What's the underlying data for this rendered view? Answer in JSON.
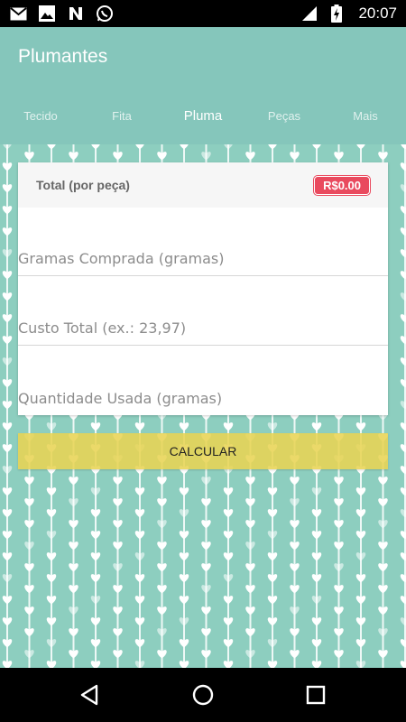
{
  "status_bar": {
    "time": "20:07",
    "left_icons": [
      "gmail-icon",
      "photos-icon",
      "n-app-icon",
      "whatsapp-icon"
    ],
    "right_icons": [
      "wifi-icon",
      "battery-charging-icon"
    ]
  },
  "app": {
    "title": "Plumantes",
    "colors": {
      "app_bar": "#85c6bb",
      "pattern_bg": "#8dcebf",
      "badge": "#e94a5e",
      "button": "#e8d454"
    }
  },
  "tabs": [
    {
      "label": "Tecido",
      "active": false
    },
    {
      "label": "Fita",
      "active": false
    },
    {
      "label": "Pluma",
      "active": true
    },
    {
      "label": "Peças",
      "active": false
    },
    {
      "label": "Mais",
      "active": false
    }
  ],
  "card": {
    "header_title": "Total (por peça)",
    "total_badge": "R$0.00",
    "fields": [
      {
        "placeholder": "Gramas Comprada (gramas)",
        "value": ""
      },
      {
        "placeholder": "Custo Total (ex.: 23,97)",
        "value": ""
      },
      {
        "placeholder": "Quantidade Usada (gramas)",
        "value": ""
      }
    ]
  },
  "calculate_label": "CALCULAR",
  "nav": [
    "back-icon",
    "home-icon",
    "recents-icon"
  ]
}
